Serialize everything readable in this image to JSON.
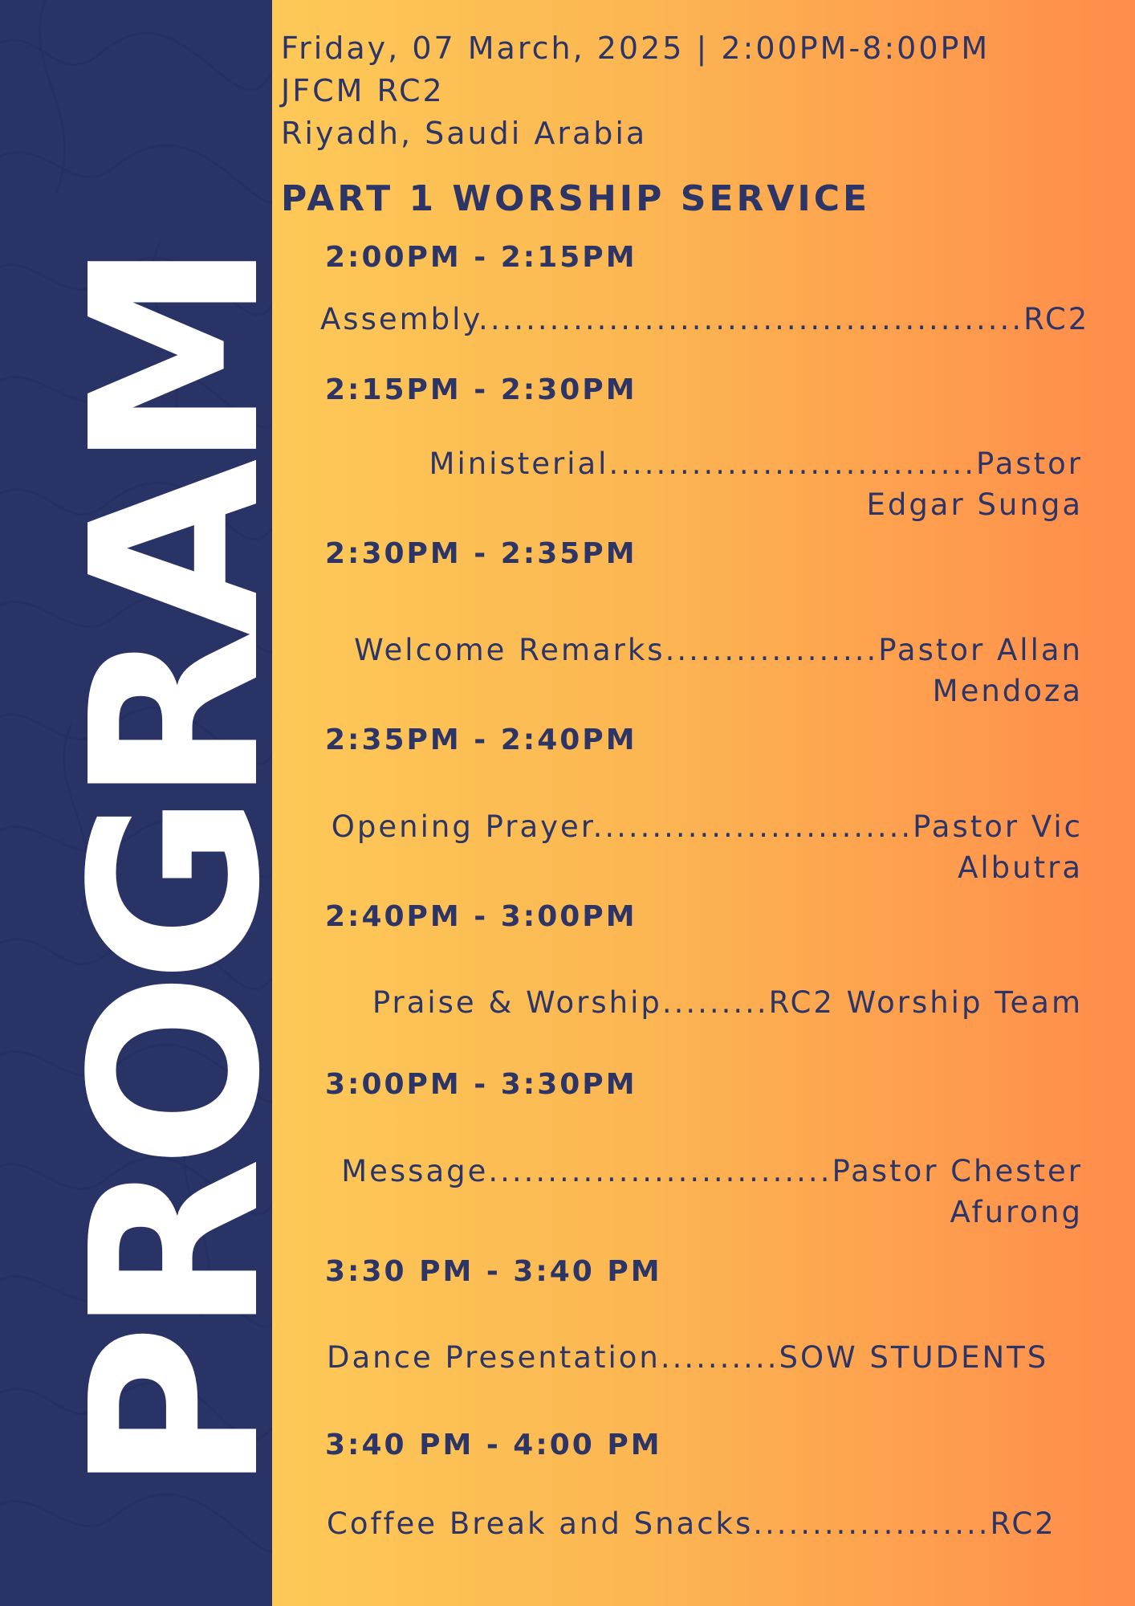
{
  "sidebar": {
    "title": "PROGRAM"
  },
  "header": {
    "date_line": "Friday, 07 March, 2025 | 2:00PM-8:00PM",
    "venue": "JFCM RC2",
    "location": "Riyadh, Saudi Arabia"
  },
  "section": {
    "title": "PART 1 WORSHIP SERVICE"
  },
  "program": [
    {
      "time": "2:00PM - 2:15PM",
      "item": "Assembly..............................................RC2"
    },
    {
      "time": "2:15PM - 2:30PM",
      "item": "Ministerial...............................Pastor Edgar Sunga"
    },
    {
      "time": "2:30PM - 2:35PM",
      "item": "Welcome Remarks..................Pastor Allan Mendoza"
    },
    {
      "time": "2:35PM - 2:40PM",
      "item": "Opening Prayer...........................Pastor Vic Albutra"
    },
    {
      "time": "2:40PM - 3:00PM",
      "item": "Praise & Worship.........RC2 Worship Team"
    },
    {
      "time": "3:00PM - 3:30PM",
      "item": "Message.............................Pastor Chester Afurong"
    },
    {
      "time": "3:30 PM - 3:40 PM",
      "item": "Dance Presentation..........SOW STUDENTS"
    },
    {
      "time": "3:40 PM - 4:00 PM",
      "item": "Coffee Break and Snacks....................RC2"
    }
  ]
}
